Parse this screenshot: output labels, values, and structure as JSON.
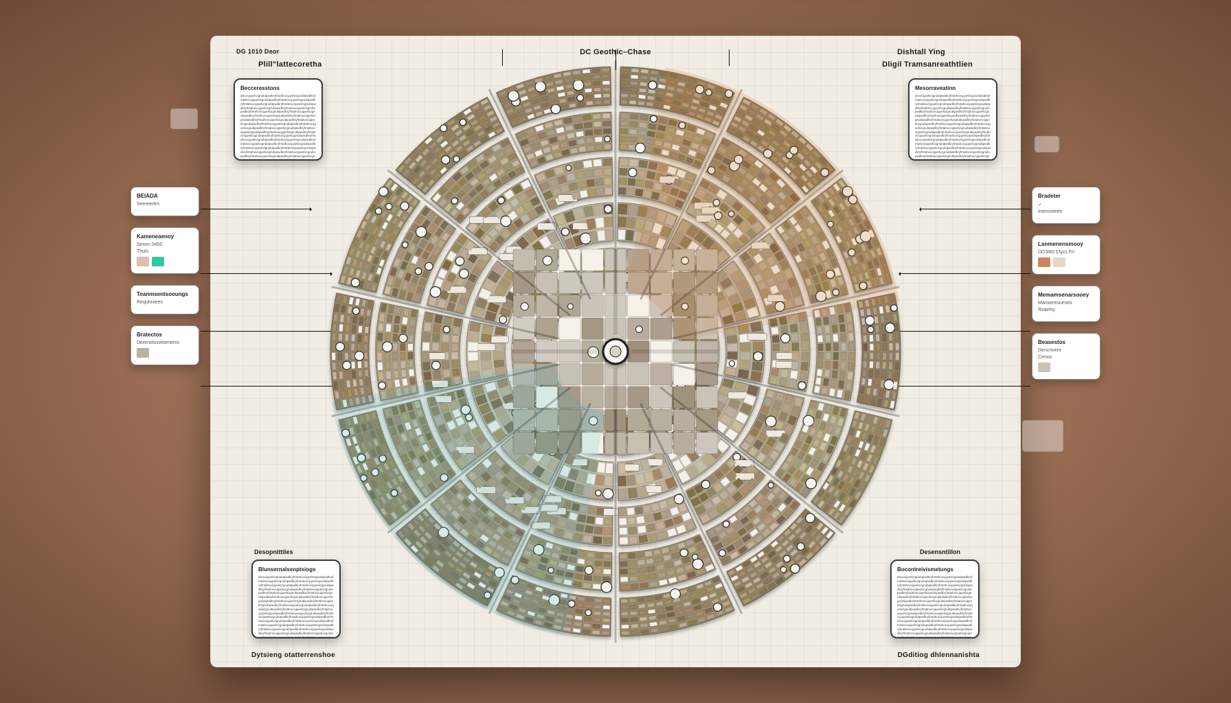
{
  "titles": {
    "top_center": "DC Geothic–Chase",
    "top_left": "Plill\"lattecoretha",
    "top_right": "Dligil Tramsanreathtlien",
    "top_left2": "DG 1010 Deor",
    "top_right2": "Dishtall Ying",
    "bottom_left": "Dytsieng otatterrenshoe",
    "bottom_right": "DGditiog dhlennanishta",
    "panel_bl": "Desopnittiles",
    "panel_br": "Desensntillon",
    "panel_tl": "Becceresstons",
    "panel_tr": "Mesorraveatinn",
    "panel_bl_sub": "Blunsernalsenptsiogs",
    "panel_br_sub": "Bocontreivismetungs"
  },
  "side_left": [
    {
      "title": "BEIADA",
      "sub": "Seereertrn"
    },
    {
      "title": "Kameneaenoy",
      "sub": "Sexen 0450",
      "sub2": "Thuls",
      "swatches": [
        "#d6c1ae",
        "#34c7a4"
      ]
    },
    {
      "title": "Teanmsentsooungs",
      "sub": "Requhraees"
    },
    {
      "title": "Bratectos",
      "swatches": [
        "#b9b1a3"
      ],
      "sub": "Deernetssvetenems"
    }
  ],
  "side_right": [
    {
      "title": "Bradeter",
      "check": true,
      "sub": "Intemreettn"
    },
    {
      "title": "Lanmenensmooy",
      "sub": "DD3Itt0 Clycs Fn",
      "swatches": [
        "#d0835d",
        "#e7d8c2"
      ]
    },
    {
      "title": "Memamsenarsooey",
      "sub": "Manseresnenes",
      "sub2": "Rsaelsy"
    },
    {
      "title": "Beasestos",
      "swatches": [
        "#c9c2b6"
      ],
      "sub": "Dencrivenr",
      "sub2": "Cenos"
    }
  ],
  "radial": {
    "sectors": 14,
    "rings": 5,
    "tint_angles": {
      "warm": [
        10,
        60
      ],
      "cool": [
        190,
        260
      ]
    }
  }
}
